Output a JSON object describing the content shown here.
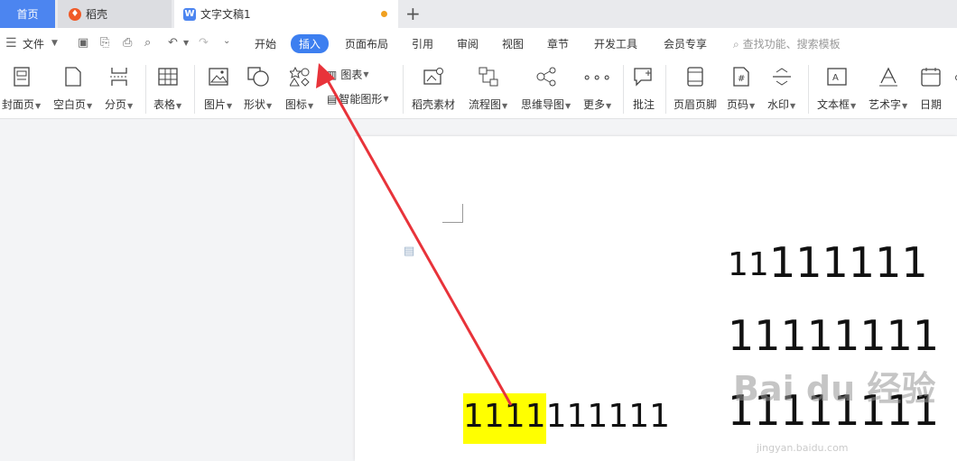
{
  "tabs": {
    "home": "首页",
    "daoke": "稻壳",
    "doc": "文字文稿1",
    "new_tab": "+"
  },
  "menu": {
    "file": "文件",
    "items": [
      "开始",
      "插入",
      "页面布局",
      "引用",
      "审阅",
      "视图",
      "章节",
      "开发工具",
      "会员专享"
    ],
    "active": "插入",
    "search": "查找功能、搜索模板"
  },
  "ribbon": {
    "cover": "封面页",
    "blank": "空白页",
    "pagebreak": "分页",
    "table": "表格",
    "picture": "图片",
    "shape": "形状",
    "icon": "图标",
    "chart": "图表",
    "smartart": "智能图形",
    "daoke_material": "稻壳素材",
    "flowchart": "流程图",
    "mindmap": "思维导图",
    "more": "更多",
    "comment": "批注",
    "header_footer": "页眉页脚",
    "page_number": "页码",
    "watermark": "水印",
    "textbox": "文本框",
    "wordart": "艺术字",
    "date": "日期"
  },
  "document": {
    "line1_small": "11",
    "line1_large": "111111",
    "line2": "11111111",
    "line3": "11111111",
    "left_highlight": "1111",
    "left_rest": "111111"
  },
  "watermark": {
    "brand": "Bai du 经验",
    "url": "jingyan.baidu.com"
  },
  "colors": {
    "accent": "#3d7ff0",
    "highlight": "#ffff00",
    "arrow": "#e8333a"
  }
}
